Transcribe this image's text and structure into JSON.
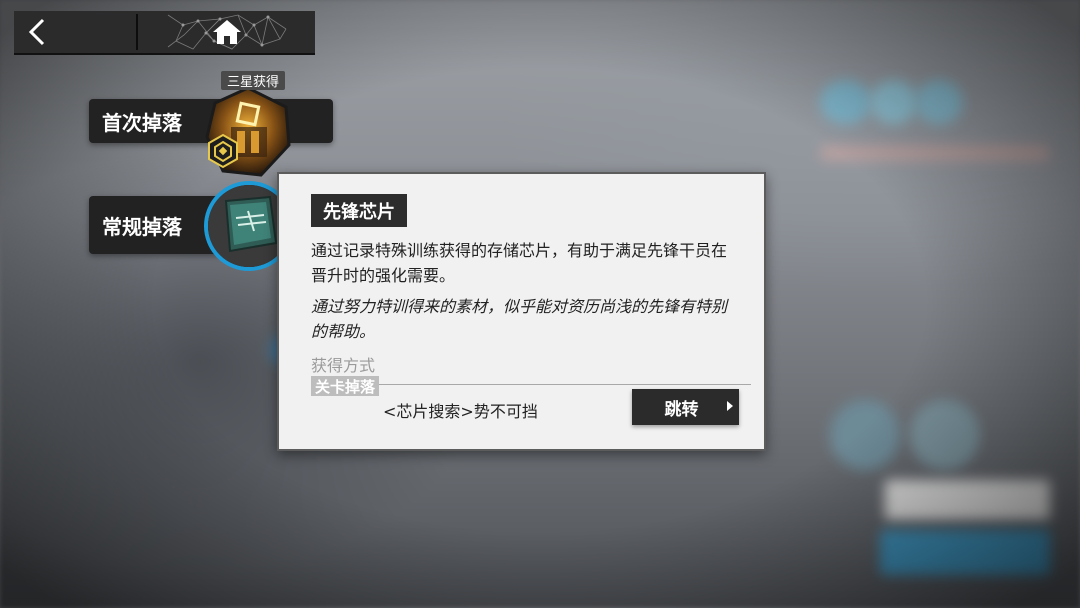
{
  "nav": {
    "back_icon": "chevron-left-icon",
    "home_icon": "home-icon"
  },
  "drops": {
    "first": {
      "label": "首次掉落",
      "tag": "三星获得"
    },
    "normal": {
      "label": "常规掉落"
    }
  },
  "item": {
    "name": "先锋芯片",
    "description": "通过记录特殊训练获得的存储芯片，有助于满足先锋干员在晋升时的强化需要。",
    "flavor": "通过努力特训得来的素材，似乎能对资历尚浅的先锋有特别的帮助。",
    "obtain_label": "获得方式",
    "stage_tag": "关卡掉落",
    "stage_name": "<芯片搜索>势不可挡",
    "jump_label": "跳转"
  },
  "colors": {
    "accent_blue": "#1e9ad6",
    "badge_gold": "#e8c84a"
  }
}
